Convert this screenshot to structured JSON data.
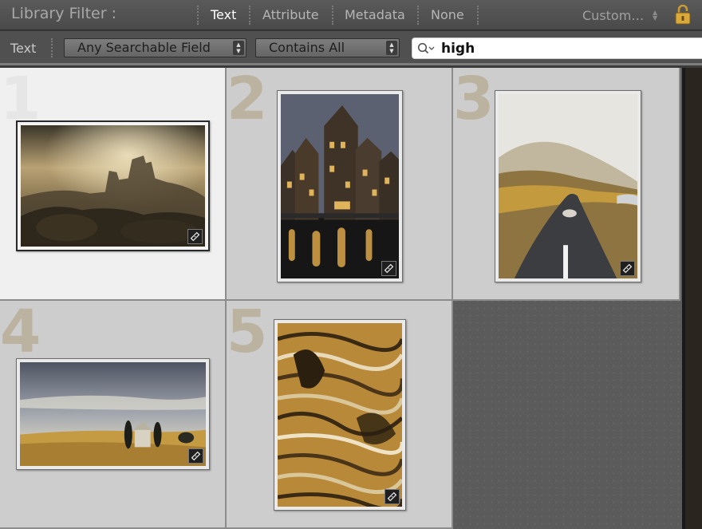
{
  "filter_bar": {
    "title": "Library Filter :",
    "modes": [
      "Text",
      "Attribute",
      "Metadata",
      "None"
    ],
    "active_mode": "Text",
    "preset": "Custom…"
  },
  "text_filter": {
    "label": "Text",
    "field_dropdown": "Any Searchable Field",
    "rule_dropdown": "Contains All",
    "search_value": "high"
  },
  "grid": {
    "cells": [
      {
        "number": "1",
        "scene": "castle-ruins",
        "selected": true
      },
      {
        "number": "2",
        "scene": "canal-houses-night",
        "selected": false
      },
      {
        "number": "3",
        "scene": "misty-road",
        "selected": false
      },
      {
        "number": "4",
        "scene": "chapel-field",
        "selected": false
      },
      {
        "number": "5",
        "scene": "rice-terraces",
        "selected": false
      }
    ]
  },
  "icons": {
    "lock": "lock-icon",
    "search": "search-icon",
    "badge": "develop-settings-badge-icon",
    "dropdown": "dropdown-arrows-icon"
  },
  "colors": {
    "accent_number": "#b9ae98",
    "selected_cell": "#f0f0f0",
    "cell": "#cdcdcd",
    "empty_grid": "#5b5b5b",
    "active_mode": "#ffffff"
  }
}
